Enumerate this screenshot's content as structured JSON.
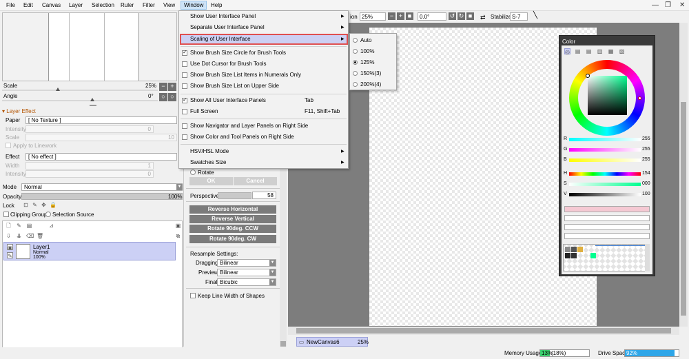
{
  "menubar": {
    "items": [
      "File",
      "Edit",
      "Canvas",
      "Layer",
      "Selection",
      "Ruler",
      "Filter",
      "View",
      "Window",
      "Help"
    ]
  },
  "toolbar": {
    "rotation_label": "ion",
    "zoom": "25%",
    "angle": "0.0°",
    "stabilizer_label": "Stabilizer",
    "stabilizer_value": "S-7"
  },
  "navigator": {
    "scale_label": "Scale",
    "scale_value": "25%",
    "angle_label": "Angle",
    "angle_value": "0°"
  },
  "layer_effect": {
    "title": "Layer Effect",
    "paper_label": "Paper",
    "paper_value": "[ No Texture ]",
    "intensity_label": "Intensity",
    "intensity_value": "0",
    "scale_label": "Scale",
    "scale_value": "10",
    "apply_linework": "Apply to Linework",
    "effect_label": "Effect",
    "effect_value": "[ No effect ]",
    "width_label": "Width",
    "width_value": "1",
    "intensity2_label": "Intensity",
    "intensity2_value": "0"
  },
  "layer_props": {
    "mode_label": "Mode",
    "mode_value": "Normal",
    "opacity_label": "Opacity",
    "opacity_value": "100%",
    "lock_label": "Lock",
    "clipping_label": "Clipping Group",
    "selection_source_label": "Selection Source"
  },
  "layer": {
    "name": "Layer1",
    "mode": "Normal",
    "opacity": "100%"
  },
  "transform": {
    "rotate_label": "Rotate",
    "ok_label": "OK",
    "cancel_label": "Cancel",
    "perspective_label": "Perspective",
    "perspective_value": "58",
    "buttons": [
      "Reverse Horizontal",
      "Reverse Vertical",
      "Rotate 90deg. CCW",
      "Rotate 90deg. CW"
    ],
    "resample_title": "Resample Settings:",
    "dragging_label": "Dragging",
    "dragging_value": "Bilinear",
    "preview_label": "Preview",
    "preview_value": "Bilinear",
    "final_label": "Final",
    "final_value": "Bicubic",
    "keep_line_width": "Keep Line Width of Shapes"
  },
  "color_panel": {
    "title": "Color",
    "r_label": "R",
    "r_value": "255",
    "g_label": "G",
    "g_value": "255",
    "b_label": "B",
    "b_value": "255",
    "h_label": "H",
    "h_value": "154",
    "s_label": "S",
    "s_value": "000",
    "v_label": "V",
    "v_value": "100"
  },
  "window_menu": {
    "items": [
      {
        "label": "Show User Interface Panel",
        "submenu": true
      },
      {
        "label": "Separate User Interface Panel",
        "submenu": true
      },
      {
        "label": "Scaling of User Interface",
        "submenu": true
      },
      {
        "label": "Show Brush Size Circle for Brush Tools",
        "checked": true
      },
      {
        "label": "Use Dot Cursor for Brush Tools",
        "checked": false
      },
      {
        "label": "Show Brush Size List Items in Numerals Only",
        "checked": false
      },
      {
        "label": "Show Brush Size List on Upper Side",
        "checked": false
      },
      {
        "label": "Show All User Interface Panels",
        "checked": true,
        "shortcut": "Tab"
      },
      {
        "label": "Full Screen",
        "checked": false,
        "shortcut": "F11, Shift+Tab"
      },
      {
        "label": "Show Navigator and Layer Panels on Right Side",
        "checked": false
      },
      {
        "label": "Show Color and Tool Panels on Right Side",
        "checked": false
      },
      {
        "label": "HSV/HSL Mode",
        "submenu": true
      },
      {
        "label": "Swatches Size",
        "submenu": true
      }
    ]
  },
  "scaling_submenu": {
    "options": [
      "Auto",
      "100%",
      "125%",
      "150%(3)",
      "200%(4)"
    ],
    "selected": "125%"
  },
  "canvas_tab": {
    "name": "NewCanvas6",
    "zoom": "25%"
  },
  "status": {
    "memory_label": "Memory Usage",
    "memory_value": "13%",
    "memory_extra": "(18%)",
    "drive_label": "Drive Space",
    "drive_value": "92%"
  },
  "colors": {
    "accent": "#ccd0f5",
    "highlight_border": "#e05050",
    "section_head": "#b35400"
  }
}
